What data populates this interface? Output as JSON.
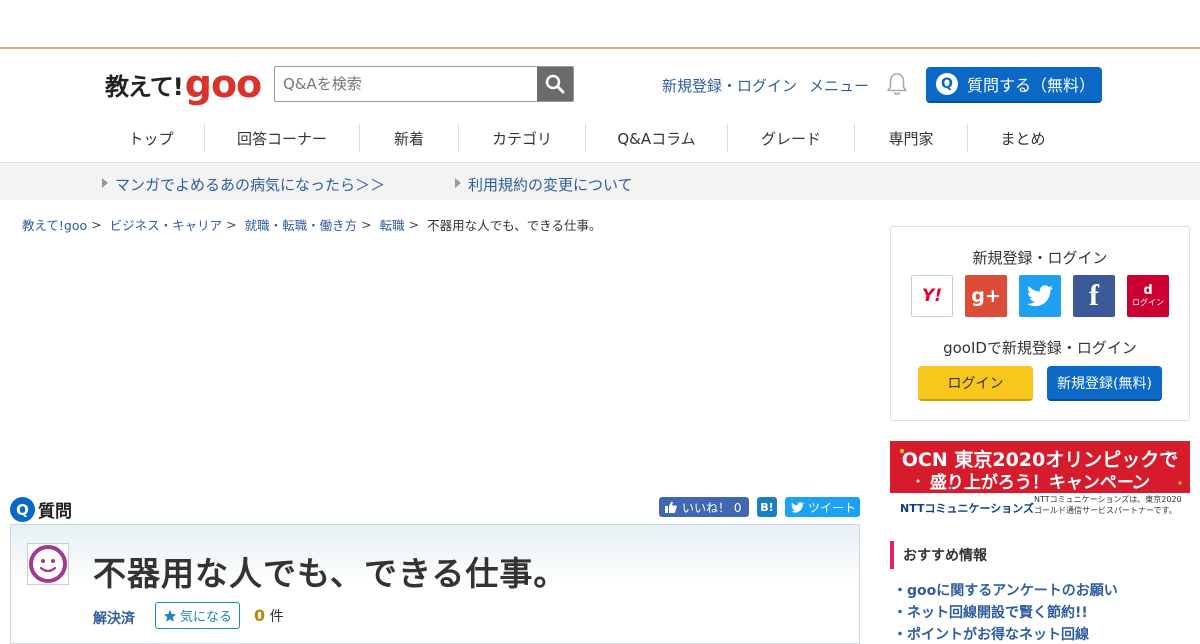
{
  "header": {
    "logo_text": "教えて!",
    "logo_goo": "goo",
    "search_placeholder": "Q&Aを検索",
    "register_login": "新規登録・ログイン",
    "menu": "メニュー",
    "ask_badge": "Q",
    "ask_button": "質問する（無料）"
  },
  "nav": {
    "items": [
      {
        "label": "トップ"
      },
      {
        "label": "回答コーナー"
      },
      {
        "label": "新着"
      },
      {
        "label": "カテゴリ"
      },
      {
        "label": "Q&Aコラム"
      },
      {
        "label": "グレード"
      },
      {
        "label": "専門家"
      },
      {
        "label": "まとめ"
      }
    ]
  },
  "notices": [
    {
      "label": "マンガでよめるあの病気になったら＞＞"
    },
    {
      "label": "利用規約の変更について"
    }
  ],
  "breadcrumb": {
    "items": [
      "教えて!goo",
      "ビジネス・キャリア",
      "就職・転職・働き方",
      "転職"
    ],
    "separator": ">",
    "current": "不器用な人でも、できる仕事。"
  },
  "question": {
    "badge": "Q",
    "label": "質問",
    "title": "不器用な人でも、できる仕事。",
    "status": "解決済",
    "favorite": "気になる",
    "count": "0",
    "count_unit": "件"
  },
  "share": {
    "like": "いいね！ 0",
    "hatena": "B!",
    "tweet": "ツイート"
  },
  "login_box": {
    "title": "新規登録・ログイン",
    "sns": [
      {
        "name": "yahoo",
        "label": "Y!"
      },
      {
        "name": "google-plus",
        "label": "g+"
      },
      {
        "name": "twitter",
        "label": ""
      },
      {
        "name": "facebook",
        "label": "f"
      },
      {
        "name": "docomo",
        "label": "ログイン"
      }
    ],
    "sns_docomo_mark": "d",
    "goo_id": "gooIDで新規登録・ログイン",
    "login": "ログイン",
    "register": "新規登録(無料)"
  },
  "ad": {
    "line1": "OCN 東京2020オリンピックで",
    "line2": "盛り上がろう！キャンペーン",
    "brand": "NTTコミュニケーションズ",
    "note": "NTTコミュニケーションズは、東京2020ゴールド通信サービスパートナーです。"
  },
  "recommend": {
    "title": "おすすめ情報",
    "items": [
      "・gooに関するアンケートのお願い",
      "・ネット回線開設で賢く節約!!",
      "・ポイントがお得なネット回線"
    ]
  },
  "colors": {
    "accent_blue": "#0a69c7",
    "link": "#2f5d9e",
    "goo_red": "#d8342c",
    "top_border": "#f4a26b"
  }
}
